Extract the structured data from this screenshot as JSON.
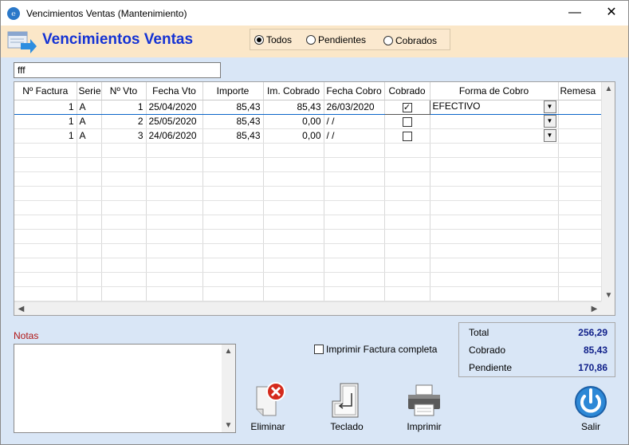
{
  "window": {
    "title": "Vencimientos Ventas (Mantenimiento)",
    "minimize": "—",
    "close": "✕"
  },
  "header": {
    "title": "Vencimientos Ventas",
    "filters": [
      {
        "label": "Todos",
        "selected": true
      },
      {
        "label": "Pendientes",
        "selected": false
      },
      {
        "label": "Cobrados",
        "selected": false
      }
    ]
  },
  "search": {
    "value": "fff"
  },
  "grid": {
    "columns": [
      "Nº Factura",
      "Serie",
      "Nº Vto",
      "Fecha Vto",
      "Importe",
      "Im. Cobrado",
      "Fecha Cobro",
      "Cobrado",
      "Forma de Cobro",
      "Remesa"
    ],
    "rows": [
      {
        "factura": "1",
        "serie": "A",
        "vto": "1",
        "fecha_vto": "25/04/2020",
        "importe": "85,43",
        "cobrado_imp": "85,43",
        "fecha_cobro": "26/03/2020",
        "cobrado": true,
        "forma": "EFECTIVO",
        "remesa": ""
      },
      {
        "factura": "1",
        "serie": "A",
        "vto": "2",
        "fecha_vto": "25/05/2020",
        "importe": "85,43",
        "cobrado_imp": "0,00",
        "fecha_cobro": "/ /",
        "cobrado": false,
        "forma": "",
        "remesa": ""
      },
      {
        "factura": "1",
        "serie": "A",
        "vto": "3",
        "fecha_vto": "24/06/2020",
        "importe": "85,43",
        "cobrado_imp": "0,00",
        "fecha_cobro": "/ /",
        "cobrado": false,
        "forma": "",
        "remesa": ""
      }
    ],
    "empty_rows": 12
  },
  "notes": {
    "label": "Notas",
    "value": ""
  },
  "print_option": {
    "label": "Imprimir Factura completa",
    "checked": false
  },
  "totals": {
    "total_label": "Total",
    "total": "256,29",
    "cobrado_label": "Cobrado",
    "cobrado": "85,43",
    "pendiente_label": "Pendiente",
    "pendiente": "170,86"
  },
  "toolbar": {
    "eliminar": "Eliminar",
    "teclado": "Teclado",
    "imprimir": "Imprimir",
    "salir": "Salir"
  },
  "colors": {
    "header_bg": "#fbe7c8",
    "title_blue": "#1533d4",
    "window_bg": "#d9e6f6",
    "notes_label": "#b01515",
    "totals_value": "#10208a"
  }
}
